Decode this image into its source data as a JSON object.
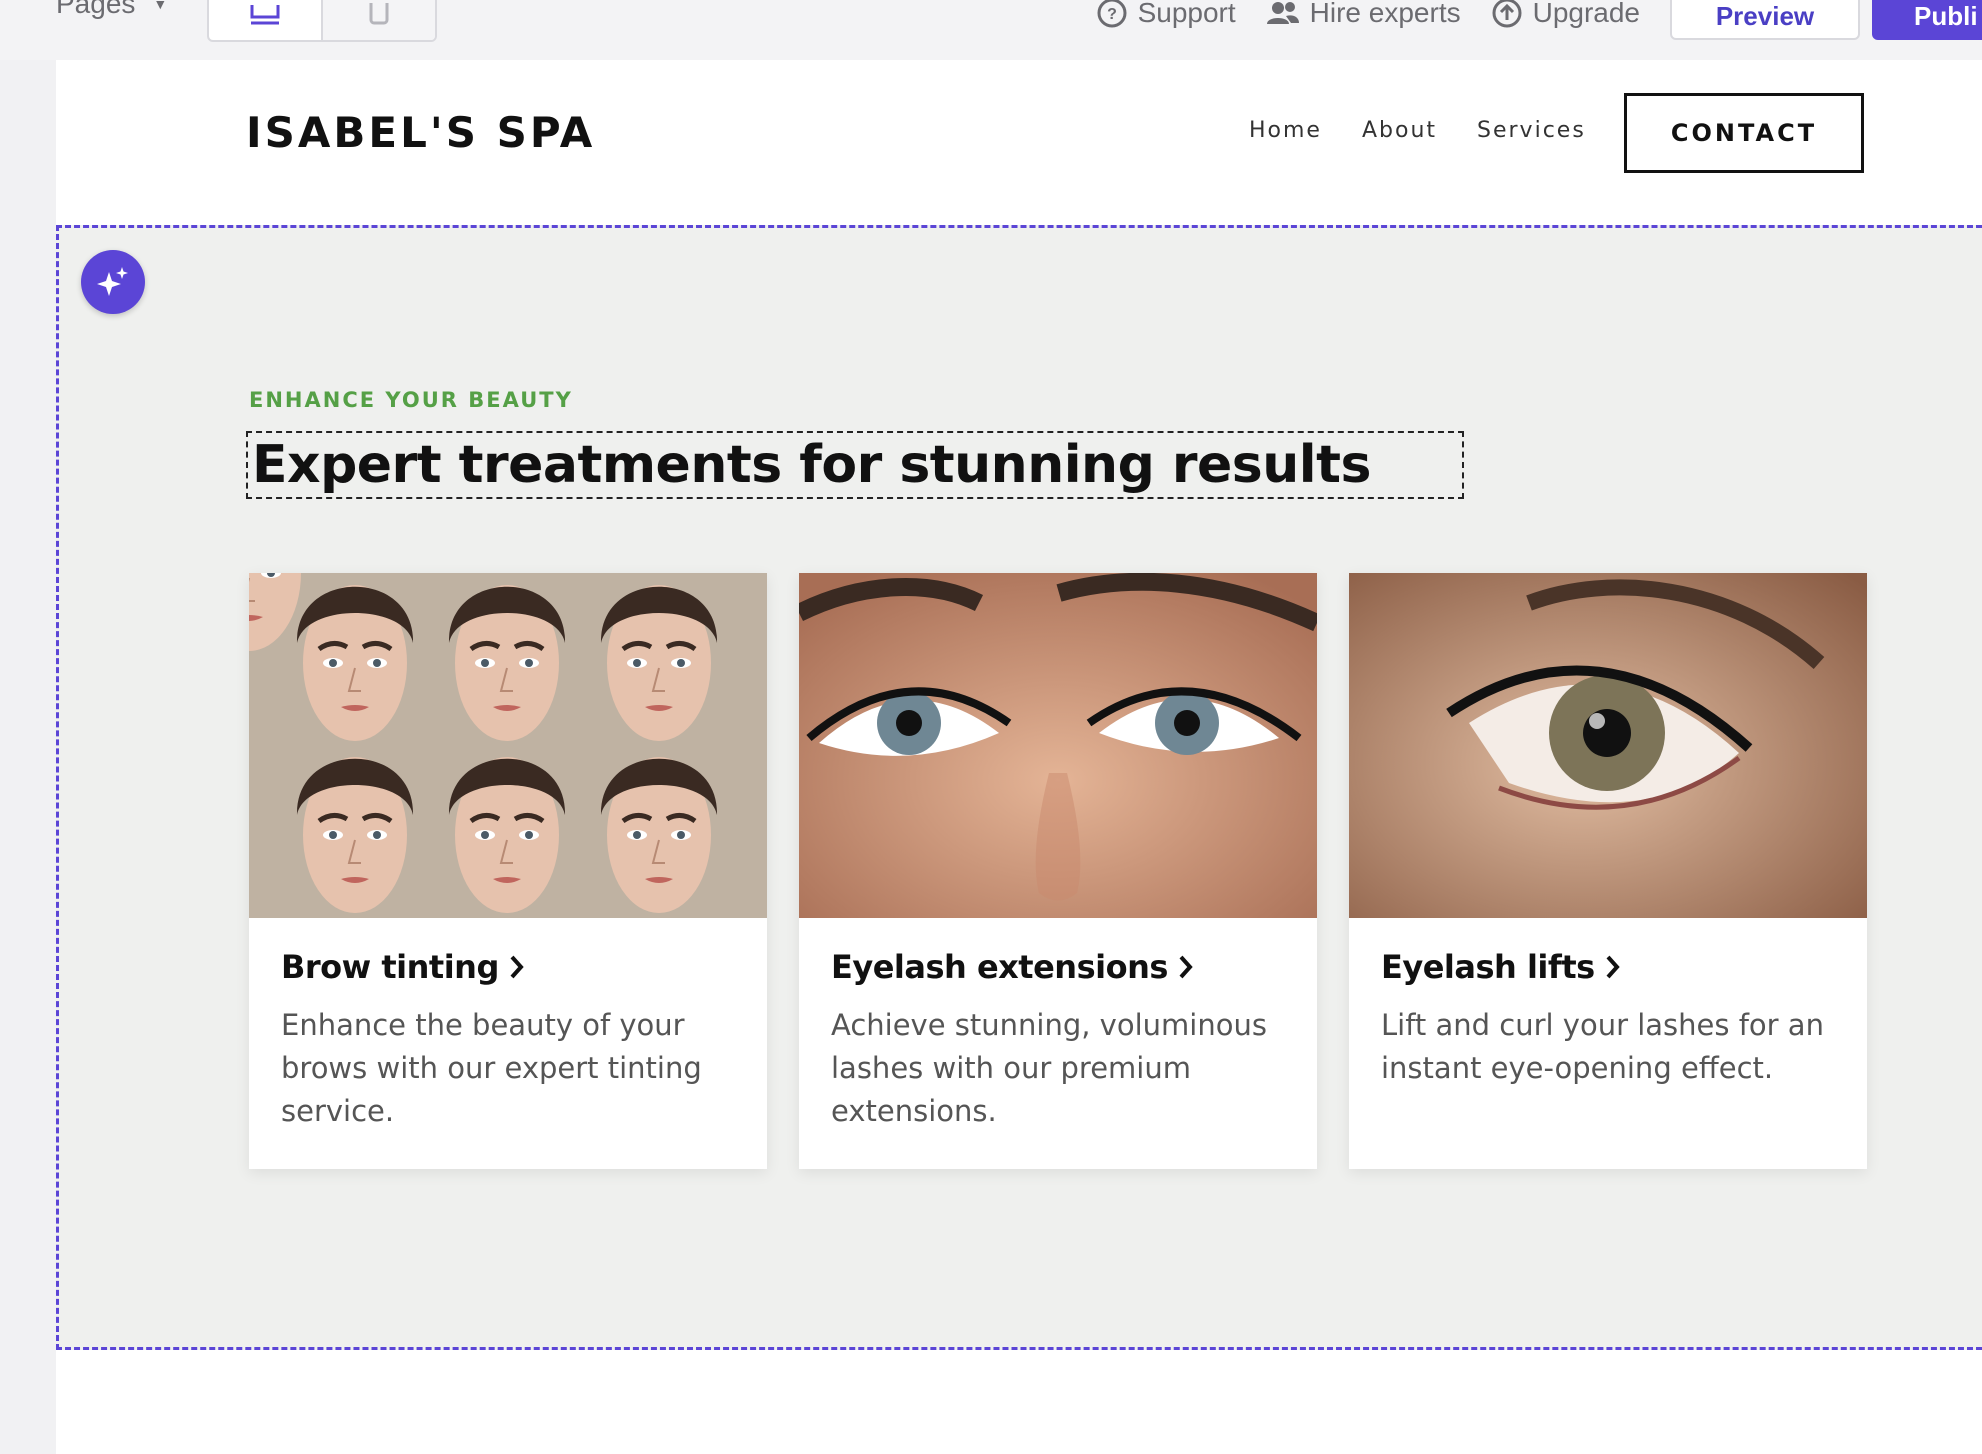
{
  "editor": {
    "pages_label": "Pages",
    "support_label": "Support",
    "hire_label": "Hire experts",
    "upgrade_label": "Upgrade",
    "preview_label": "Preview",
    "publish_label": "Publi",
    "accent_color": "#5b45d6"
  },
  "site": {
    "brand": "ISABEL'S SPA",
    "nav": [
      "Home",
      "About",
      "Services"
    ],
    "contact_label": "CONTACT"
  },
  "section": {
    "eyebrow": "ENHANCE YOUR BEAUTY",
    "heading": "Expert treatments for stunning results",
    "eyebrow_color": "#55a046",
    "cards": [
      {
        "title": "Brow tinting",
        "text": "Enhance the beauty of your brows with our expert tinting service."
      },
      {
        "title": "Eyelash extensions",
        "text": "Achieve stunning, voluminous lashes with our premium extensions."
      },
      {
        "title": "Eyelash lifts",
        "text": "Lift and curl your lashes for an instant eye-opening effect."
      }
    ]
  }
}
